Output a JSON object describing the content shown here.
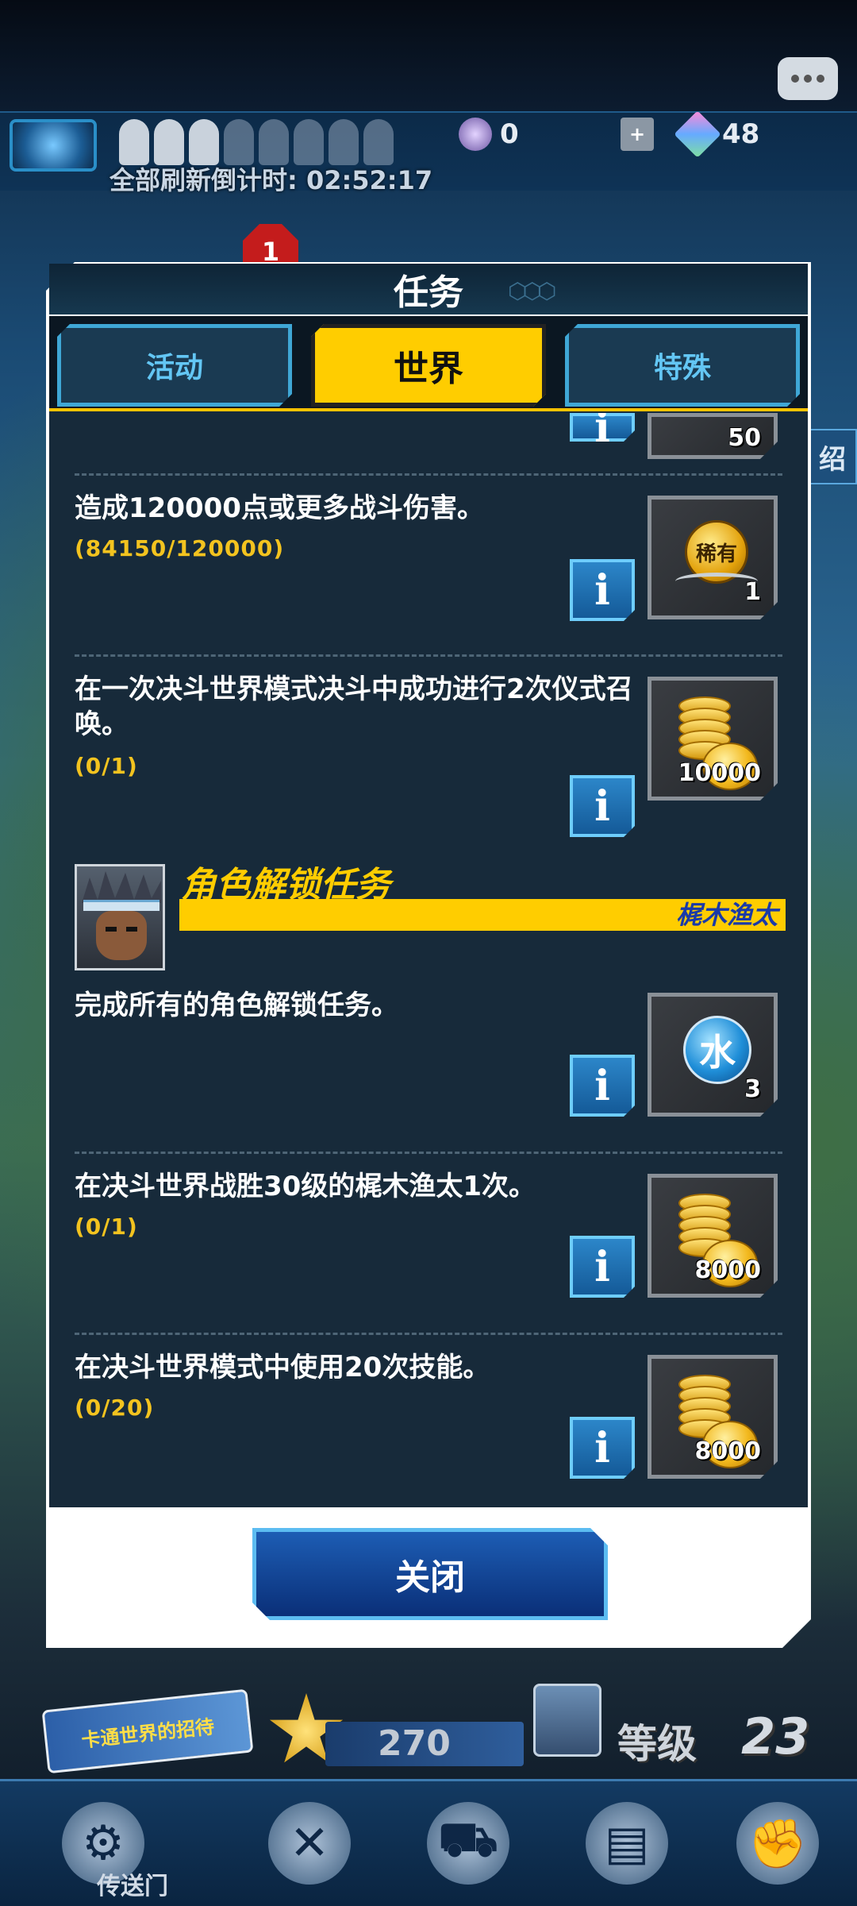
{
  "topbar": {
    "currency_1": "0",
    "currency_2": "48",
    "refresh_countdown": "全部刷新倒计时: 02:52:17",
    "notification_count": "1"
  },
  "side_tab_right": "绍",
  "modal": {
    "title": "任务",
    "tabs": [
      {
        "label": "活动",
        "active": false
      },
      {
        "label": "世界",
        "active": true
      },
      {
        "label": "特殊",
        "active": false
      }
    ],
    "partial_reward_qty": "50",
    "missions": [
      {
        "text": "造成120000点或更多战斗伤害。",
        "progress": "(84150/120000)",
        "reward_type": "rare-medal",
        "reward_label": "稀有",
        "reward_qty": "1"
      },
      {
        "text": "在一次决斗世界模式决斗中成功进行2次仪式召唤。",
        "progress": "(0/1)",
        "reward_type": "gold-coins",
        "reward_qty": "10000"
      }
    ],
    "character_section": {
      "title": "角色解锁任务",
      "character_name": "梶木渔太"
    },
    "character_missions": [
      {
        "text": "完成所有的角色解锁任务。",
        "progress": "",
        "reward_type": "water-orb",
        "reward_label": "水",
        "reward_qty": "3"
      },
      {
        "text": "在决斗世界战胜30级的梶木渔太1次。",
        "progress": "(0/1)",
        "reward_type": "gold-coins",
        "reward_qty": "8000"
      },
      {
        "text": "在决斗世界模式中使用20次技能。",
        "progress": "(0/20)",
        "reward_type": "gold-coins",
        "reward_qty": "8000"
      }
    ],
    "info_symbol": "i",
    "close_label": "关闭"
  },
  "hud": {
    "banner_text": "卡通世界的招待",
    "points": "270",
    "level_label": "等级",
    "level_value": "23"
  },
  "nav": {
    "gate_label": "传送门"
  },
  "colors": {
    "accent_yellow": "#ffcd00",
    "panel_bg": "#172a3a",
    "progress_text": "#f3c31f",
    "button_blue": "#1d5db4",
    "character_name": "#1a3aa8"
  }
}
